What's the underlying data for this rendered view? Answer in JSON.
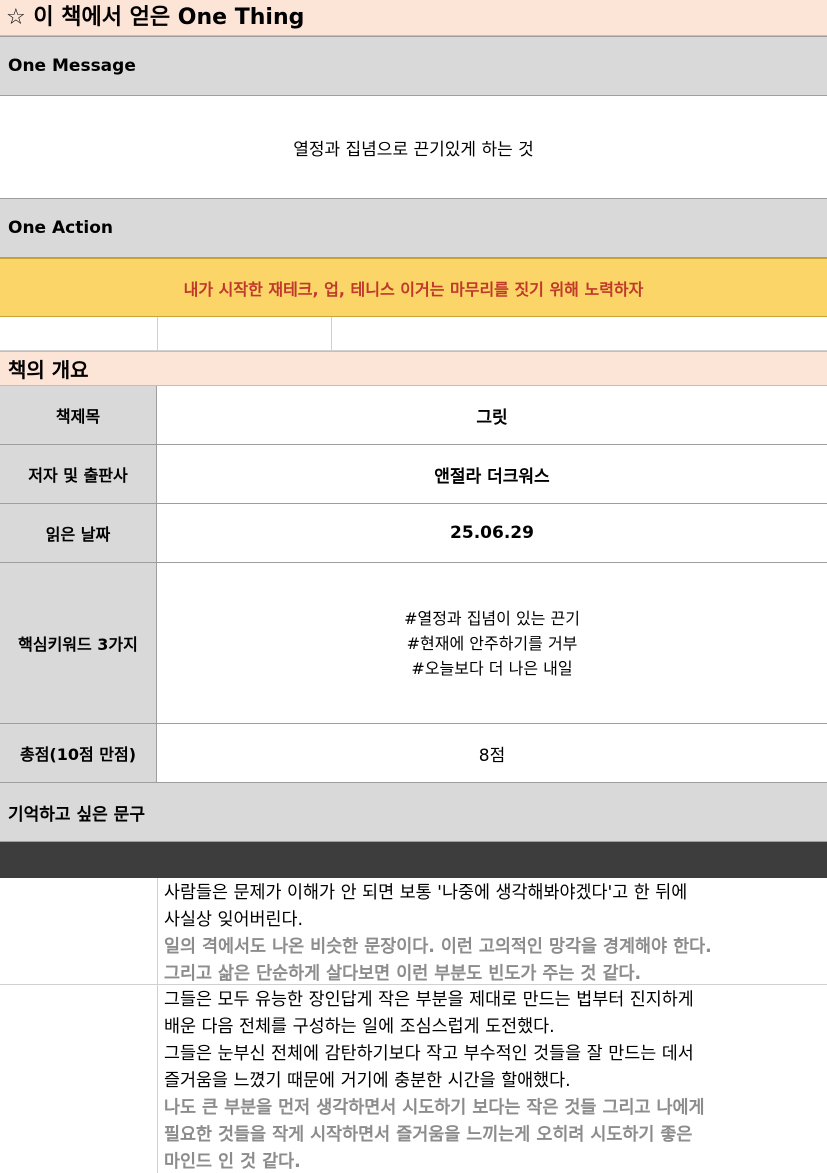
{
  "header": {
    "title": "☆ 이 책에서 얻은 One Thing"
  },
  "one_message": {
    "label": "One Message",
    "text": "열정과 집념으로 끈기있게 하는 것"
  },
  "one_action": {
    "label": "One Action",
    "text": "내가 시작한 재테크, 업, 테니스 이거는 마무리를 짓기 위해 노력하자"
  },
  "overview": {
    "title": "책의 개요",
    "book_title_label": "책제목",
    "book_title": "그릿",
    "author_label": "저자 및 출판사",
    "author": "앤절라 더크워스",
    "date_label": "읽은 날짜",
    "date": "25.06.29",
    "keywords_label": "핵심키워드 3가지",
    "keywords": [
      "#열정과 집념이 있는 끈기",
      "#현재에 안주하기를 거부",
      "#오늘보다 더 나은 내일"
    ],
    "score_label": "총점(10점 만점)",
    "score": "8점"
  },
  "quotes": {
    "title": "기억하고 싶은 문구",
    "items": [
      {
        "quote_lines": [
          "사람들은 문제가 이해가 안 되면 보통 '나중에 생각해봐야겠다'고 한 뒤에",
          "사실상 잊어버린다."
        ],
        "comment_lines": [
          "일의 격에서도 나온 비슷한 문장이다. 이런 고의적인 망각을 경계해야 한다.",
          "그리고 삶은 단순하게 살다보면 이런 부분도 빈도가 주는 것 같다."
        ]
      },
      {
        "quote_lines": [
          "그들은 모두 유능한 장인답게 작은 부분을 제대로 만드는 법부터 진지하게",
          "배운 다음 전체를 구성하는 일에 조심스럽게 도전했다.",
          "그들은 눈부신 전체에 감탄하기보다 작고 부수적인 것들을 잘 만드는 데서",
          "즐거움을 느꼈기 때문에 거기에 충분한 시간을 할애했다."
        ],
        "comment_lines": [
          "나도 큰 부분을 먼저 생각하면서 시도하기 보다는 작은 것들 그리고 나에게",
          "필요한 것들을 작게 시작하면서 즐거움을 느끼는게 오히려 시도하기 좋은",
          "마인드 인 것 같다."
        ]
      }
    ]
  }
}
